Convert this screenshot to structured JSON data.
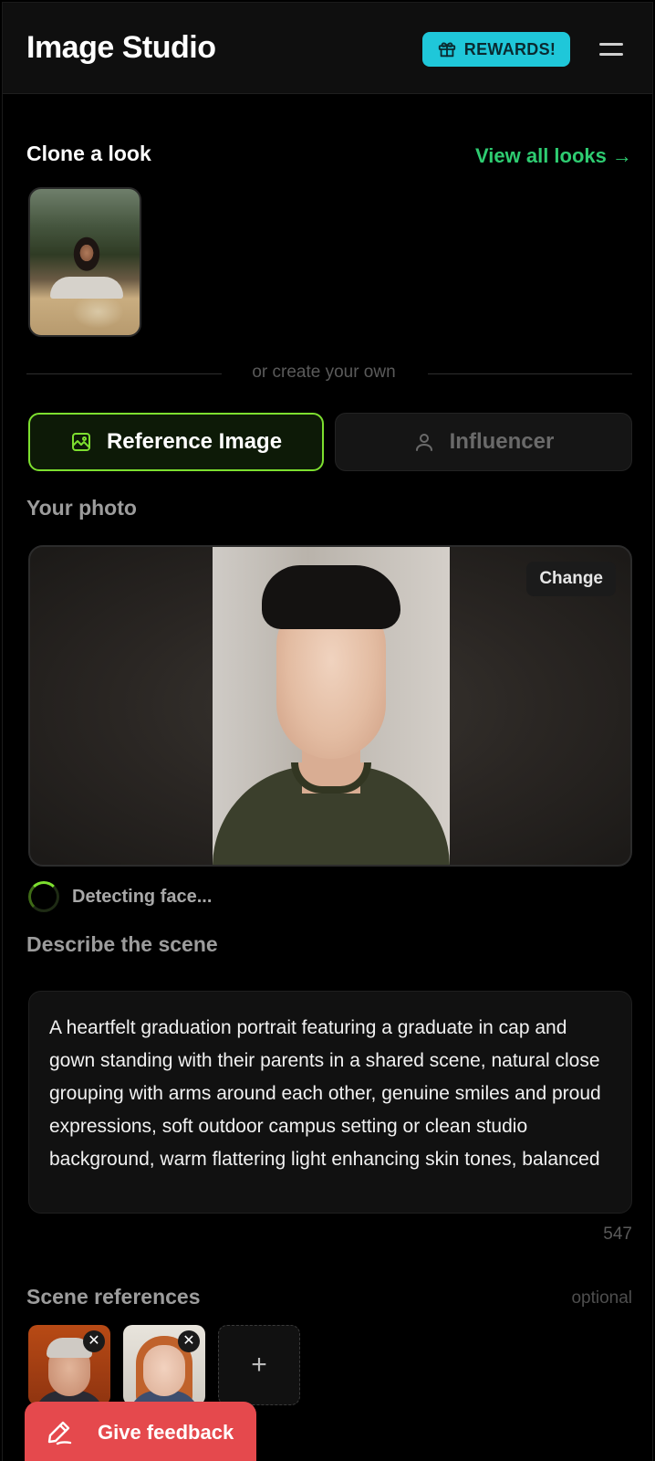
{
  "app": {
    "title": "Image Studio",
    "rewards_label": "REWARDS!",
    "accent_color": "#7ddf2f",
    "rewards_color": "#1fc7d9",
    "link_color": "#2ecc71",
    "feedback_color": "#e5494d"
  },
  "clone_section": {
    "title": "Clone a look",
    "view_all_label": "View all looks",
    "view_all_arrow": "→"
  },
  "divider_text": "or create your own",
  "modes": {
    "reference_label": "Reference Image",
    "influencer_label": "Influencer",
    "active": "Reference Image"
  },
  "photo": {
    "label": "Your photo",
    "change_label": "Change",
    "status_text": "Detecting face..."
  },
  "scene": {
    "label": "Describe the scene",
    "text": "A heartfelt graduation portrait featuring a graduate in cap and gown standing with their parents in a shared scene, natural close grouping with arms around each other, genuine smiles and proud expressions, soft outdoor campus setting or clean studio background, warm flattering light enhancing skin tones, balanced",
    "char_count": "547"
  },
  "references": {
    "label": "Scene references",
    "optional_label": "optional",
    "remove_symbol": "✕",
    "add_symbol": "+"
  },
  "feedback": {
    "label": "Give feedback"
  }
}
